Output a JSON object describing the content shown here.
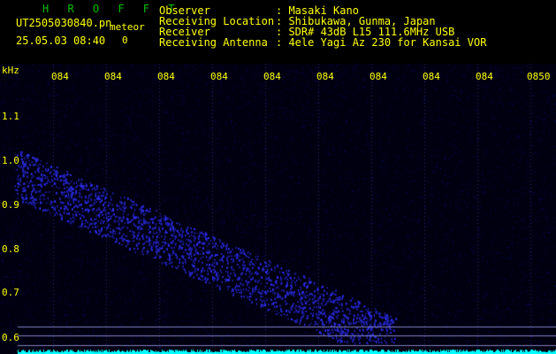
{
  "header": {
    "title": "H R O F F T",
    "filename": "UT2505030840.pn",
    "meteor_label": "meteor",
    "datetime": "25.05.03 08:40",
    "count": "0",
    "info": [
      {
        "label": "Observer",
        "value": ": Masaki Kano"
      },
      {
        "label": "Receiving Location",
        "value": ": Shibukawa, Gunma, Japan"
      },
      {
        "label": "Receiver",
        "value": ": SDR# 43dB L15 111.6MHz USB"
      },
      {
        "label": "Receiving Antenna",
        "value": ": 4ele Yagi Az 230 for Kansai VOR"
      }
    ]
  },
  "spectrogram": {
    "unit": "kHz",
    "y_ticks": [
      "1.1",
      "1.0",
      "0.9",
      "0.8",
      "0.7",
      "0.6"
    ],
    "x_ticks": [
      "084",
      "084",
      "084",
      "084",
      "084",
      "084",
      "084",
      "084",
      "084",
      "0850"
    ],
    "colors": {
      "background": "#000010",
      "signal": "#3030ff",
      "baseline": "#00ffff",
      "grid": "#8080c0"
    }
  }
}
